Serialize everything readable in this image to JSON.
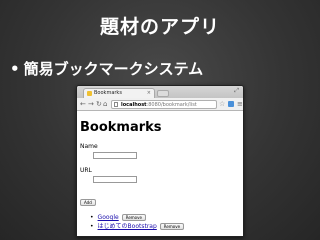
{
  "slide": {
    "title": "題材のアプリ",
    "bullet": "簡易ブックマークシステム"
  },
  "browser": {
    "tab_title": "Bookmarks",
    "tab_close": "×",
    "url_host": "localhost",
    "url_path": ":8080/bookmark/list",
    "back_icon": "←",
    "forward_icon": "→",
    "reload_icon": "↻",
    "home_icon": "⌂",
    "star_icon": "☆",
    "menu_icon": "≡",
    "resize_icon": "⤢"
  },
  "page": {
    "heading": "Bookmarks",
    "name_label": "Name",
    "url_label": "URL",
    "add_label": "Add",
    "remove_label": "Remove",
    "bookmarks": [
      {
        "title": "Google"
      },
      {
        "title": "はじめてのBootstrap"
      }
    ]
  }
}
